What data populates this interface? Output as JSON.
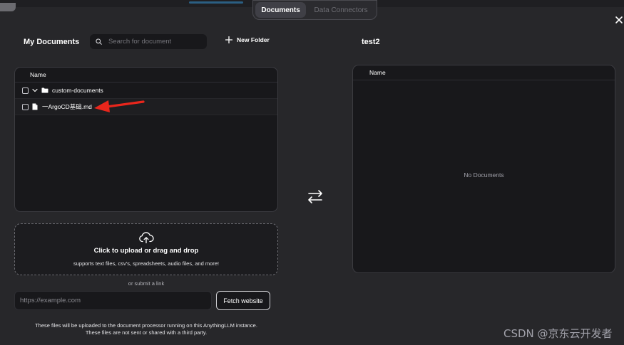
{
  "tabs": {
    "documents": "Documents",
    "data_connectors": "Data Connectors"
  },
  "left": {
    "title": "My Documents",
    "search_placeholder": "Search for document",
    "new_folder_label": "New Folder",
    "table_header": "Name",
    "folder_name": "custom-documents",
    "file_name": "一ArgoCD基础.md"
  },
  "upload": {
    "title": "Click to upload or drag and drop",
    "subtitle": "supports text files, csv's, spreadsheets, audio files, and more!",
    "or_submit_link": "or submit a link",
    "url_placeholder": "https://example.com",
    "fetch_button": "Fetch website",
    "footnote_line1": "These files will be uploaded to the document processor running on this AnythingLLM instance.",
    "footnote_line2": "These files are not sent or shared with a third party."
  },
  "right": {
    "title": "test2",
    "table_header": "Name",
    "empty_text": "No Documents"
  },
  "watermark": "CSDN @京东云开发者",
  "colors": {
    "annotation_arrow": "#e8261c",
    "background": "#27272a",
    "panel": "#18181b"
  }
}
